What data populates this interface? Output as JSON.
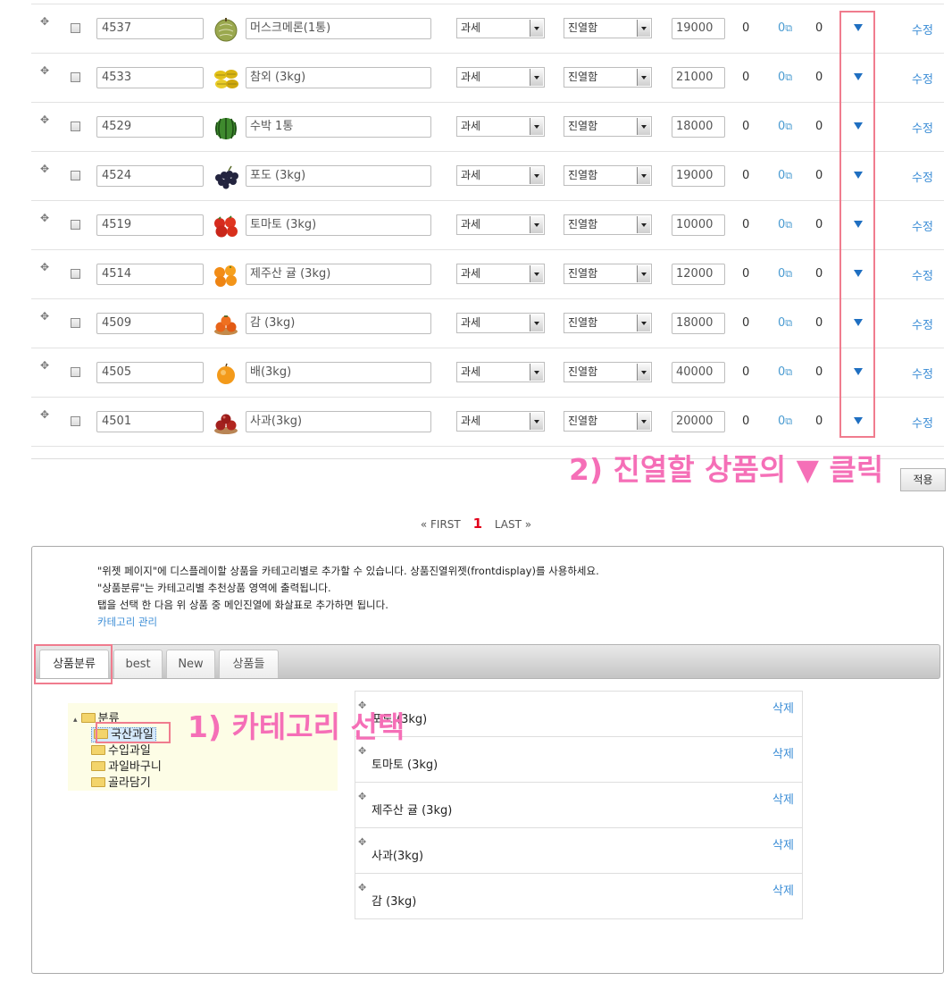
{
  "products": [
    {
      "code": "4537",
      "name": "머스크메론(1통)",
      "tax": "과세",
      "display": "진열함",
      "price": "19000",
      "sold": "0",
      "link_count": "0",
      "stock": "0",
      "edit": "수정",
      "thumb": "melon"
    },
    {
      "code": "4533",
      "name": "참외 (3kg)",
      "tax": "과세",
      "display": "진열함",
      "price": "21000",
      "sold": "0",
      "link_count": "0",
      "stock": "0",
      "edit": "수정",
      "thumb": "oriental-melon"
    },
    {
      "code": "4529",
      "name": "수박 1통",
      "tax": "과세",
      "display": "진열함",
      "price": "18000",
      "sold": "0",
      "link_count": "0",
      "stock": "0",
      "edit": "수정",
      "thumb": "watermelon"
    },
    {
      "code": "4524",
      "name": "포도 (3kg)",
      "tax": "과세",
      "display": "진열함",
      "price": "19000",
      "sold": "0",
      "link_count": "0",
      "stock": "0",
      "edit": "수정",
      "thumb": "grape"
    },
    {
      "code": "4519",
      "name": "토마토 (3kg)",
      "tax": "과세",
      "display": "진열함",
      "price": "10000",
      "sold": "0",
      "link_count": "0",
      "stock": "0",
      "edit": "수정",
      "thumb": "tomato"
    },
    {
      "code": "4514",
      "name": "제주산 귤 (3kg)",
      "tax": "과세",
      "display": "진열함",
      "price": "12000",
      "sold": "0",
      "link_count": "0",
      "stock": "0",
      "edit": "수정",
      "thumb": "tangerine"
    },
    {
      "code": "4509",
      "name": "감 (3kg)",
      "tax": "과세",
      "display": "진열함",
      "price": "18000",
      "sold": "0",
      "link_count": "0",
      "stock": "0",
      "edit": "수정",
      "thumb": "persimmon"
    },
    {
      "code": "4505",
      "name": "배(3kg)",
      "tax": "과세",
      "display": "진열함",
      "price": "40000",
      "sold": "0",
      "link_count": "0",
      "stock": "0",
      "edit": "수정",
      "thumb": "pear"
    },
    {
      "code": "4501",
      "name": "사과(3kg)",
      "tax": "과세",
      "display": "진열함",
      "price": "20000",
      "sold": "0",
      "link_count": "0",
      "stock": "0",
      "edit": "수정",
      "thumb": "apple"
    }
  ],
  "annotation_step2": "2) 진열할 상품의 ▼ 클릭",
  "annotation_step1": "1) 카테고리 선택",
  "apply_button": "적용",
  "pager": {
    "first": "« FIRST",
    "current": "1",
    "last": "LAST »"
  },
  "help": {
    "line1": "\"위젯 페이지\"에 디스플레이할 상품을 카테고리별로 추가할 수 있습니다. 상품진열위젯(frontdisplay)를 사용하세요.",
    "line2": "\"상품분류\"는 카테고리별 추천상품 영역에 출력됩니다.",
    "line3": "탭을 선택 한 다음 위 상품 중 메인진열에 화살표로 추가하면 됩니다.",
    "link": "카테고리 관리"
  },
  "tabs": [
    "상품분류",
    "best",
    "New",
    "상품들"
  ],
  "tree": {
    "root": "분류",
    "children": [
      "국산과일",
      "수입과일",
      "과일바구니",
      "골라담기"
    ]
  },
  "display_items": [
    {
      "name": "포도 (3kg)",
      "delete": "삭제"
    },
    {
      "name": "토마토 (3kg)",
      "delete": "삭제"
    },
    {
      "name": "제주산 귤 (3kg)",
      "delete": "삭제"
    },
    {
      "name": "사과(3kg)",
      "delete": "삭제"
    },
    {
      "name": "감 (3kg)",
      "delete": "삭제"
    }
  ],
  "colors": {
    "annotation": "#f56fb7",
    "highlight_box": "#f07c8e",
    "link": "#3b8dd6",
    "arrow": "#1f6fc1",
    "pager_current": "#e2001a"
  },
  "icons": {
    "drag": "drag-handle-icon",
    "move_down": "triangle-down-icon",
    "external": "external-link-icon",
    "folder": "folder-icon"
  }
}
